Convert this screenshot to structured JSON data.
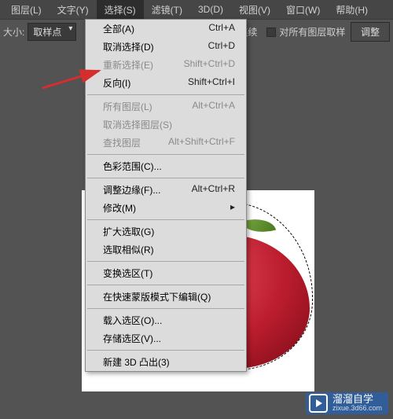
{
  "menubar": {
    "items": [
      {
        "label": "图层(L)"
      },
      {
        "label": "文字(Y)"
      },
      {
        "label": "选择(S)"
      },
      {
        "label": "滤镜(T)"
      },
      {
        "label": "3D(D)"
      },
      {
        "label": "视图(V)"
      },
      {
        "label": "窗口(W)"
      },
      {
        "label": "帮助(H)"
      }
    ],
    "active_index": 2
  },
  "options": {
    "size_label": "大小:",
    "size_value": "取样点",
    "swatch_label": "连续",
    "swatch_checked": true,
    "sample_all_label": "对所有图层取样",
    "sample_all_checked": false,
    "adjust_btn": "调整"
  },
  "menu": {
    "groups": [
      [
        {
          "label": "全部(A)",
          "shortcut": "Ctrl+A",
          "enabled": true
        },
        {
          "label": "取消选择(D)",
          "shortcut": "Ctrl+D",
          "enabled": true
        },
        {
          "label": "重新选择(E)",
          "shortcut": "Shift+Ctrl+D",
          "enabled": false
        },
        {
          "label": "反向(I)",
          "shortcut": "Shift+Ctrl+I",
          "enabled": true
        }
      ],
      [
        {
          "label": "所有图层(L)",
          "shortcut": "Alt+Ctrl+A",
          "enabled": false
        },
        {
          "label": "取消选择图层(S)",
          "shortcut": "",
          "enabled": false
        },
        {
          "label": "查找图层",
          "shortcut": "Alt+Shift+Ctrl+F",
          "enabled": false
        }
      ],
      [
        {
          "label": "色彩范围(C)...",
          "shortcut": "",
          "enabled": true
        }
      ],
      [
        {
          "label": "调整边缘(F)...",
          "shortcut": "Alt+Ctrl+R",
          "enabled": true
        },
        {
          "label": "修改(M)",
          "shortcut": "▸",
          "enabled": true
        }
      ],
      [
        {
          "label": "扩大选取(G)",
          "shortcut": "",
          "enabled": true
        },
        {
          "label": "选取相似(R)",
          "shortcut": "",
          "enabled": true
        }
      ],
      [
        {
          "label": "变换选区(T)",
          "shortcut": "",
          "enabled": true
        }
      ],
      [
        {
          "label": "在快速蒙版模式下编辑(Q)",
          "shortcut": "",
          "enabled": true
        }
      ],
      [
        {
          "label": "载入选区(O)...",
          "shortcut": "",
          "enabled": true
        },
        {
          "label": "存储选区(V)...",
          "shortcut": "",
          "enabled": true
        }
      ],
      [
        {
          "label": "新建 3D 凸出(3)",
          "shortcut": "",
          "enabled": true
        }
      ]
    ]
  },
  "watermark": {
    "title": "溜溜自学",
    "sub": "zixue.3d66.com"
  }
}
